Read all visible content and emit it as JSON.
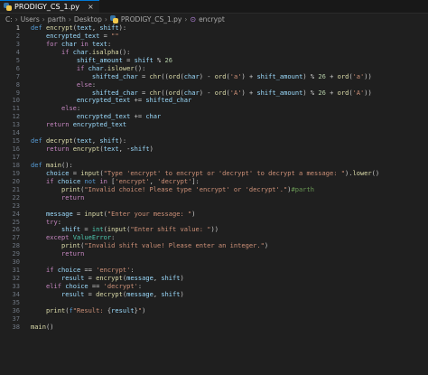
{
  "tab": {
    "title": "PRODIGY_CS_1.py",
    "close": "×"
  },
  "breadcrumb": [
    "C:",
    "Users",
    "parth",
    "Desktop",
    "PRODIGY_CS_1.py",
    "encrypt"
  ],
  "code_lines": [
    {
      "n": "1",
      "tokens": [
        [
          "k",
          "def"
        ],
        [
          "t",
          " "
        ],
        [
          "f",
          "encrypt"
        ],
        [
          "t",
          "("
        ],
        [
          "v",
          "text"
        ],
        [
          "t",
          ", "
        ],
        [
          "v",
          "shift"
        ],
        [
          "t",
          "):"
        ]
      ]
    },
    {
      "n": "2",
      "tokens": [
        [
          "t",
          "    "
        ],
        [
          "v",
          "encrypted_text"
        ],
        [
          "t",
          " = "
        ],
        [
          "s",
          "\"\""
        ]
      ]
    },
    {
      "n": "3",
      "tokens": [
        [
          "t",
          "    "
        ],
        [
          "kc",
          "for"
        ],
        [
          "t",
          " "
        ],
        [
          "v",
          "char"
        ],
        [
          "t",
          " "
        ],
        [
          "kc",
          "in"
        ],
        [
          "t",
          " "
        ],
        [
          "v",
          "text"
        ],
        [
          "t",
          ":"
        ]
      ]
    },
    {
      "n": "4",
      "tokens": [
        [
          "t",
          "        "
        ],
        [
          "kc",
          "if"
        ],
        [
          "t",
          " "
        ],
        [
          "v",
          "char"
        ],
        [
          "t",
          "."
        ],
        [
          "f",
          "isalpha"
        ],
        [
          "t",
          "():"
        ]
      ]
    },
    {
      "n": "5",
      "tokens": [
        [
          "t",
          "            "
        ],
        [
          "v",
          "shift_amount"
        ],
        [
          "t",
          " = "
        ],
        [
          "v",
          "shift"
        ],
        [
          "t",
          " % "
        ],
        [
          "n",
          "26"
        ]
      ]
    },
    {
      "n": "6",
      "tokens": [
        [
          "t",
          "            "
        ],
        [
          "kc",
          "if"
        ],
        [
          "t",
          " "
        ],
        [
          "v",
          "char"
        ],
        [
          "t",
          "."
        ],
        [
          "f",
          "islower"
        ],
        [
          "t",
          "():"
        ]
      ]
    },
    {
      "n": "7",
      "tokens": [
        [
          "t",
          "                "
        ],
        [
          "v",
          "shifted_char"
        ],
        [
          "t",
          " = "
        ],
        [
          "f",
          "chr"
        ],
        [
          "t",
          "(("
        ],
        [
          "f",
          "ord"
        ],
        [
          "t",
          "("
        ],
        [
          "v",
          "char"
        ],
        [
          "t",
          ") - "
        ],
        [
          "f",
          "ord"
        ],
        [
          "t",
          "("
        ],
        [
          "s",
          "'a'"
        ],
        [
          "t",
          ") + "
        ],
        [
          "v",
          "shift_amount"
        ],
        [
          "t",
          ") % "
        ],
        [
          "n",
          "26"
        ],
        [
          "t",
          " + "
        ],
        [
          "f",
          "ord"
        ],
        [
          "t",
          "("
        ],
        [
          "s",
          "'a'"
        ],
        [
          "t",
          "))"
        ]
      ]
    },
    {
      "n": "8",
      "tokens": [
        [
          "t",
          "            "
        ],
        [
          "kc",
          "else"
        ],
        [
          "t",
          ":"
        ]
      ]
    },
    {
      "n": "9",
      "tokens": [
        [
          "t",
          "                "
        ],
        [
          "v",
          "shifted_char"
        ],
        [
          "t",
          " = "
        ],
        [
          "f",
          "chr"
        ],
        [
          "t",
          "(("
        ],
        [
          "f",
          "ord"
        ],
        [
          "t",
          "("
        ],
        [
          "v",
          "char"
        ],
        [
          "t",
          ") - "
        ],
        [
          "f",
          "ord"
        ],
        [
          "t",
          "("
        ],
        [
          "s",
          "'A'"
        ],
        [
          "t",
          ") + "
        ],
        [
          "v",
          "shift_amount"
        ],
        [
          "t",
          ") % "
        ],
        [
          "n",
          "26"
        ],
        [
          "t",
          " + "
        ],
        [
          "f",
          "ord"
        ],
        [
          "t",
          "("
        ],
        [
          "s",
          "'A'"
        ],
        [
          "t",
          "))"
        ]
      ]
    },
    {
      "n": "10",
      "tokens": [
        [
          "t",
          "            "
        ],
        [
          "v",
          "encrypted_text"
        ],
        [
          "t",
          " += "
        ],
        [
          "v",
          "shifted_char"
        ]
      ]
    },
    {
      "n": "11",
      "tokens": [
        [
          "t",
          "        "
        ],
        [
          "kc",
          "else"
        ],
        [
          "t",
          ":"
        ]
      ]
    },
    {
      "n": "12",
      "tokens": [
        [
          "t",
          "            "
        ],
        [
          "v",
          "encrypted_text"
        ],
        [
          "t",
          " += "
        ],
        [
          "v",
          "char"
        ]
      ]
    },
    {
      "n": "13",
      "tokens": [
        [
          "t",
          "    "
        ],
        [
          "kc",
          "return"
        ],
        [
          "t",
          " "
        ],
        [
          "v",
          "encrypted_text"
        ]
      ]
    },
    {
      "n": "14",
      "tokens": []
    },
    {
      "n": "15",
      "tokens": [
        [
          "k",
          "def"
        ],
        [
          "t",
          " "
        ],
        [
          "f",
          "decrypt"
        ],
        [
          "t",
          "("
        ],
        [
          "v",
          "text"
        ],
        [
          "t",
          ", "
        ],
        [
          "v",
          "shift"
        ],
        [
          "t",
          "):"
        ]
      ]
    },
    {
      "n": "16",
      "tokens": [
        [
          "t",
          "    "
        ],
        [
          "kc",
          "return"
        ],
        [
          "t",
          " "
        ],
        [
          "f",
          "encrypt"
        ],
        [
          "t",
          "("
        ],
        [
          "v",
          "text"
        ],
        [
          "t",
          ", -"
        ],
        [
          "v",
          "shift"
        ],
        [
          "t",
          ")"
        ]
      ]
    },
    {
      "n": "17",
      "tokens": []
    },
    {
      "n": "18",
      "tokens": [
        [
          "k",
          "def"
        ],
        [
          "t",
          " "
        ],
        [
          "f",
          "main"
        ],
        [
          "t",
          "():"
        ]
      ]
    },
    {
      "n": "19",
      "tokens": [
        [
          "t",
          "    "
        ],
        [
          "v",
          "choice"
        ],
        [
          "t",
          " = "
        ],
        [
          "f",
          "input"
        ],
        [
          "t",
          "("
        ],
        [
          "s",
          "\"Type 'encrypt' to encrypt or 'decrypt' to decrypt a message: \""
        ],
        [
          "t",
          ")."
        ],
        [
          "f",
          "lower"
        ],
        [
          "t",
          "()"
        ]
      ]
    },
    {
      "n": "20",
      "tokens": [
        [
          "t",
          "    "
        ],
        [
          "kc",
          "if"
        ],
        [
          "t",
          " "
        ],
        [
          "v",
          "choice"
        ],
        [
          "t",
          " "
        ],
        [
          "k",
          "not"
        ],
        [
          "t",
          " "
        ],
        [
          "kc",
          "in"
        ],
        [
          "t",
          " ["
        ],
        [
          "s",
          "'encrypt'"
        ],
        [
          "t",
          ", "
        ],
        [
          "s",
          "'decrypt'"
        ],
        [
          "t",
          "]:"
        ]
      ]
    },
    {
      "n": "21",
      "tokens": [
        [
          "t",
          "        "
        ],
        [
          "f",
          "print"
        ],
        [
          "t",
          "("
        ],
        [
          "s",
          "\"Invalid choice! Please type 'encrypt' or 'decrypt'.\""
        ],
        [
          "t",
          ")"
        ],
        [
          "c",
          "#parth"
        ]
      ]
    },
    {
      "n": "22",
      "tokens": [
        [
          "t",
          "        "
        ],
        [
          "kc",
          "return"
        ]
      ]
    },
    {
      "n": "23",
      "tokens": []
    },
    {
      "n": "24",
      "tokens": [
        [
          "t",
          "    "
        ],
        [
          "v",
          "message"
        ],
        [
          "t",
          " = "
        ],
        [
          "f",
          "input"
        ],
        [
          "t",
          "("
        ],
        [
          "s",
          "\"Enter your message: \""
        ],
        [
          "t",
          ")"
        ]
      ]
    },
    {
      "n": "25",
      "tokens": [
        [
          "t",
          "    "
        ],
        [
          "kc",
          "try"
        ],
        [
          "t",
          ":"
        ]
      ]
    },
    {
      "n": "26",
      "tokens": [
        [
          "t",
          "        "
        ],
        [
          "v",
          "shift"
        ],
        [
          "t",
          " = "
        ],
        [
          "b",
          "int"
        ],
        [
          "t",
          "("
        ],
        [
          "f",
          "input"
        ],
        [
          "t",
          "("
        ],
        [
          "s",
          "\"Enter shift value: \""
        ],
        [
          "t",
          "))"
        ]
      ]
    },
    {
      "n": "27",
      "tokens": [
        [
          "t",
          "    "
        ],
        [
          "kc",
          "except"
        ],
        [
          "t",
          " "
        ],
        [
          "b",
          "ValueError"
        ],
        [
          "t",
          ":"
        ]
      ]
    },
    {
      "n": "28",
      "tokens": [
        [
          "t",
          "        "
        ],
        [
          "f",
          "print"
        ],
        [
          "t",
          "("
        ],
        [
          "s",
          "\"Invalid shift value! Please enter an integer.\""
        ],
        [
          "t",
          ")"
        ]
      ]
    },
    {
      "n": "29",
      "tokens": [
        [
          "t",
          "        "
        ],
        [
          "kc",
          "return"
        ]
      ]
    },
    {
      "n": "30",
      "tokens": []
    },
    {
      "n": "31",
      "tokens": [
        [
          "t",
          "    "
        ],
        [
          "kc",
          "if"
        ],
        [
          "t",
          " "
        ],
        [
          "v",
          "choice"
        ],
        [
          "t",
          " == "
        ],
        [
          "s",
          "'encrypt'"
        ],
        [
          "t",
          ":"
        ]
      ]
    },
    {
      "n": "32",
      "tokens": [
        [
          "t",
          "        "
        ],
        [
          "v",
          "result"
        ],
        [
          "t",
          " = "
        ],
        [
          "f",
          "encrypt"
        ],
        [
          "t",
          "("
        ],
        [
          "v",
          "message"
        ],
        [
          "t",
          ", "
        ],
        [
          "v",
          "shift"
        ],
        [
          "t",
          ")"
        ]
      ]
    },
    {
      "n": "33",
      "tokens": [
        [
          "t",
          "    "
        ],
        [
          "kc",
          "elif"
        ],
        [
          "t",
          " "
        ],
        [
          "v",
          "choice"
        ],
        [
          "t",
          " == "
        ],
        [
          "s",
          "'decrypt'"
        ],
        [
          "t",
          ":"
        ]
      ]
    },
    {
      "n": "34",
      "tokens": [
        [
          "t",
          "        "
        ],
        [
          "v",
          "result"
        ],
        [
          "t",
          " = "
        ],
        [
          "f",
          "decrypt"
        ],
        [
          "t",
          "("
        ],
        [
          "v",
          "message"
        ],
        [
          "t",
          ", "
        ],
        [
          "v",
          "shift"
        ],
        [
          "t",
          ")"
        ]
      ]
    },
    {
      "n": "35",
      "tokens": []
    },
    {
      "n": "36",
      "tokens": [
        [
          "t",
          "    "
        ],
        [
          "f",
          "print"
        ],
        [
          "t",
          "("
        ],
        [
          "k",
          "f"
        ],
        [
          "s",
          "\"Result: "
        ],
        [
          "t",
          "{"
        ],
        [
          "v",
          "result"
        ],
        [
          "t",
          "}"
        ],
        [
          "s",
          "\""
        ],
        [
          "t",
          ")"
        ]
      ]
    },
    {
      "n": "37",
      "tokens": []
    },
    {
      "n": "38",
      "tokens": [
        [
          "f",
          "main"
        ],
        [
          "t",
          "()"
        ]
      ]
    }
  ],
  "active_line": "1",
  "colors": {
    "background": "#1f1f1f",
    "accent": "#0078d4"
  }
}
